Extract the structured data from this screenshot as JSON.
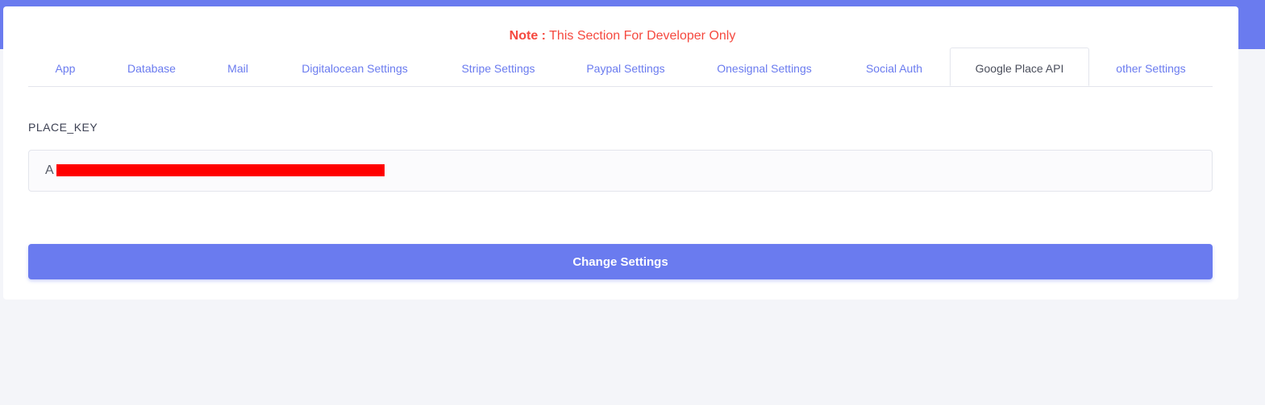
{
  "colors": {
    "accent": "#6a7bef",
    "note": "#f5493f",
    "background": "#f4f5f9"
  },
  "note": {
    "prefix": "Note :",
    "text": "This Section For Developer Only"
  },
  "tabs": [
    {
      "label": "App",
      "active": false
    },
    {
      "label": "Database",
      "active": false
    },
    {
      "label": "Mail",
      "active": false
    },
    {
      "label": "Digitalocean Settings",
      "active": false
    },
    {
      "label": "Stripe Settings",
      "active": false
    },
    {
      "label": "Paypal Settings",
      "active": false
    },
    {
      "label": "Onesignal Settings",
      "active": false
    },
    {
      "label": "Social Auth",
      "active": false
    },
    {
      "label": "Google Place API",
      "active": true
    },
    {
      "label": "other Settings",
      "active": false
    }
  ],
  "form": {
    "place_key_label": "PLACE_KEY",
    "place_key_value": "A",
    "submit_label": "Change Settings"
  }
}
